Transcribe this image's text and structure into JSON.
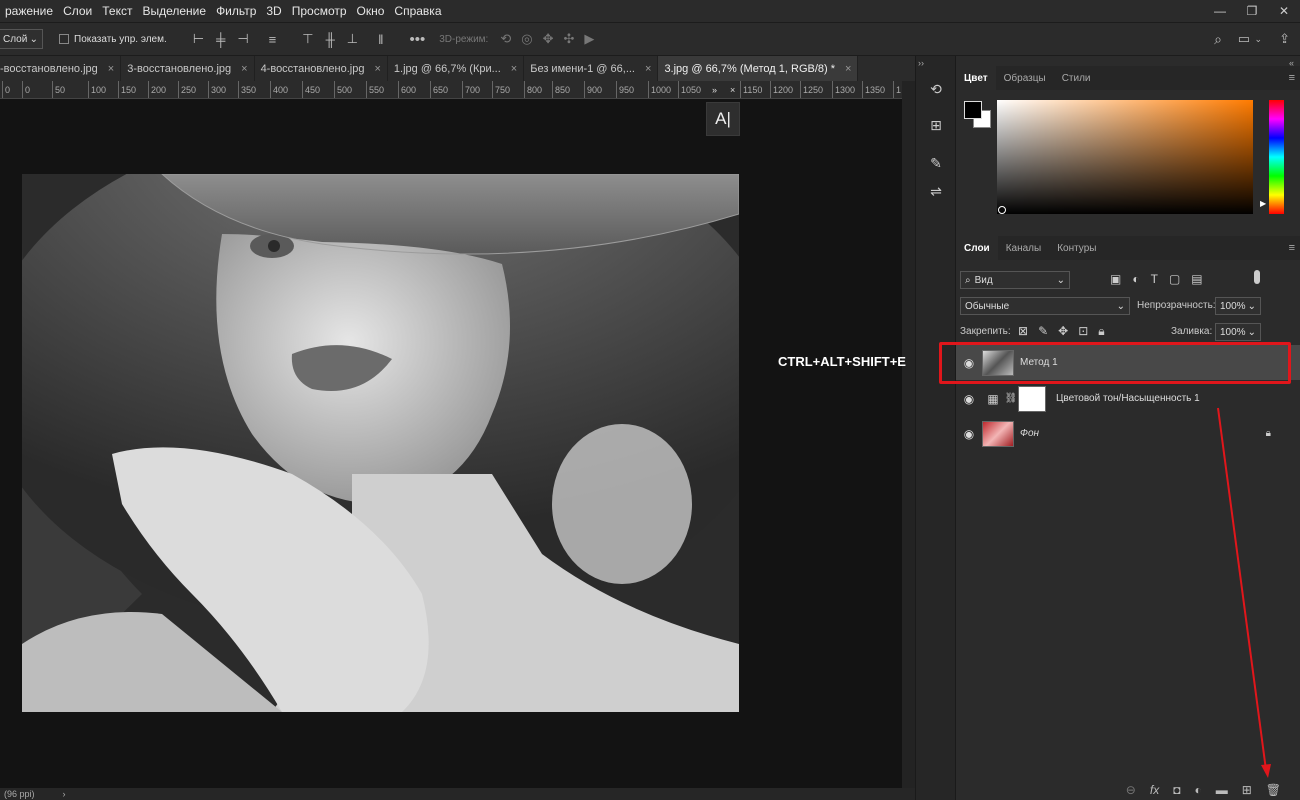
{
  "menu": [
    "ражение",
    "Слои",
    "Текст",
    "Выделение",
    "Фильтр",
    "3D",
    "Просмотр",
    "Окно",
    "Справка"
  ],
  "options": {
    "layer_select": "Слой",
    "show_controls": "Показать упр. элем.",
    "mode3d": "3D-режим:"
  },
  "tabs": [
    {
      "label": "-восстановлено.jpg",
      "active": false
    },
    {
      "label": "3-восстановлено.jpg",
      "active": false
    },
    {
      "label": "4-восстановлено.jpg",
      "active": false
    },
    {
      "label": "1.jpg @ 66,7% (Кри...",
      "active": false
    },
    {
      "label": "Без имени-1 @ 66,...",
      "active": false
    },
    {
      "label": "3.jpg @ 66,7% (Метод 1, RGB/8) *",
      "active": true
    }
  ],
  "ruler_ticks": [
    "0",
    "0",
    "50",
    "100",
    "150",
    "200",
    "250",
    "300",
    "350",
    "400",
    "450",
    "500",
    "550",
    "600",
    "650",
    "700",
    "750",
    "800",
    "850",
    "900",
    "950",
    "1000",
    "1050",
    "1150",
    "1200",
    "1250",
    "1300",
    "1350",
    "1"
  ],
  "tooltip": "A|",
  "shortcut": "CTRL+ALT+SHIFT+E",
  "status": "(96 ppi)",
  "color_panel": {
    "tabs": [
      "Цвет",
      "Образцы",
      "Стили"
    ],
    "fg_color": "#000000",
    "bg_color": "#ffffff"
  },
  "layers_panel": {
    "tabs": [
      "Слои",
      "Каналы",
      "Контуры"
    ],
    "filter": "Вид",
    "blend_mode": "Обычные",
    "opacity_label": "Непрозрачность:",
    "opacity": "100%",
    "lock_label": "Закрепить:",
    "fill_label": "Заливка:",
    "fill": "100%",
    "layers": [
      {
        "name": "Метод 1",
        "selected": true
      },
      {
        "name": "Цветовой тон/Насыщенность 1",
        "selected": false
      },
      {
        "name": "Фон",
        "selected": false,
        "locked": true
      }
    ]
  },
  "accent": "#e0161b"
}
